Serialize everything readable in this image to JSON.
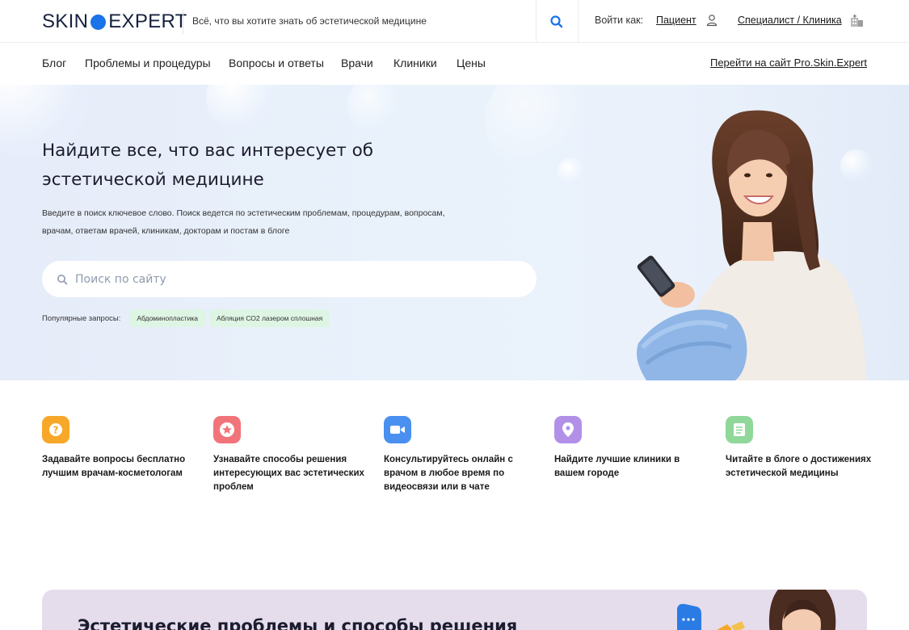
{
  "header": {
    "logo_left": "SKIN",
    "logo_right": "EXPERT",
    "tagline": "Всё, что вы хотите знать об эстетической медицине",
    "login_label": "Войти как:",
    "patient_link": "Пациент",
    "specialist_link": "Специалист / Клиника"
  },
  "nav": {
    "items": [
      "Блог",
      "Проблемы и процедуры",
      "Вопросы и ответы",
      "Врачи",
      "Клиники",
      "Цены"
    ],
    "external_link": "Перейти на сайт Pro.Skin.Expert"
  },
  "hero": {
    "title": "Найдите все, что вас интересует об эстетической медицине",
    "description": "Введите в поиск ключевое слово. Поиск ведется по эстетическим проблемам, процедурам, вопросам, врачам, ответам врачей, клиникам, докторам и постам в блоге",
    "search_placeholder": "Поиск по сайту",
    "popular_label": "Популярные запросы:",
    "popular_tags": [
      "Абдоминопластика",
      "Абляция СО2 лазером сплошная"
    ]
  },
  "features": [
    {
      "icon": "question-icon",
      "color": "#f7a829",
      "text": "Задавайте вопросы бесплатно лучшим врачам-косметологам"
    },
    {
      "icon": "star-icon",
      "color": "#f2747b",
      "text": "Узнавайте способы решения интересующих вас эстетических проблем"
    },
    {
      "icon": "video-camera-icon",
      "color": "#4a90f0",
      "text": "Консультируйтесь онлайн с врачом в любое время по видеосвязи или в чате"
    },
    {
      "icon": "location-pin-icon",
      "color": "#b390e8",
      "text": "Найдите лучшие клиники в вашем городе"
    },
    {
      "icon": "document-icon",
      "color": "#8fd89a",
      "text": "Читайте в блоге о достижениях эстетической медицины"
    }
  ],
  "bottom_section": {
    "title": "Эстетические проблемы и способы решения"
  },
  "colors": {
    "brand_blue": "#1a73e8",
    "chip_bg": "#dff5e4",
    "hero_bg": "#e9f2fb",
    "bottom_card_bg": "#e5dcec"
  }
}
